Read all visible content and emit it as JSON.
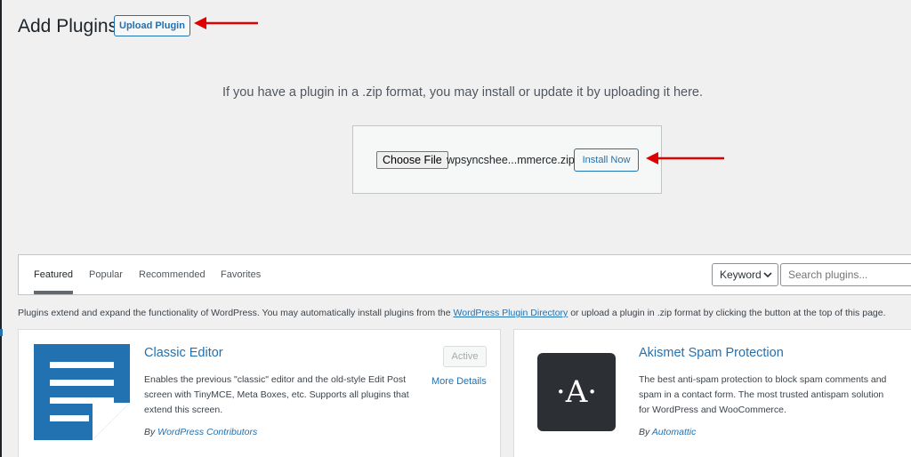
{
  "header": {
    "title": "Add Plugins",
    "upload_button": "Upload Plugin"
  },
  "upload": {
    "help_text": "If you have a plugin in a .zip format, you may install or update it by uploading it here.",
    "choose_file_label": "Choose File",
    "file_name": "wpsyncshee...mmerce.zip",
    "install_button": "Install Now"
  },
  "filter": {
    "tabs": [
      {
        "label": "Featured"
      },
      {
        "label": "Popular"
      },
      {
        "label": "Recommended"
      },
      {
        "label": "Favorites"
      }
    ],
    "search_type": "Keyword",
    "search_placeholder": "Search plugins..."
  },
  "intro": {
    "text_before": "Plugins extend and expand the functionality of WordPress. You may automatically install plugins from the ",
    "link_text": "WordPress Plugin Directory",
    "text_after": " or upload a plugin in .zip format by clicking the button at the top of this page."
  },
  "plugins": [
    {
      "name": "Classic Editor",
      "description": "Enables the previous \"classic\" editor and the old-style Edit Post screen with TinyMCE, Meta Boxes, etc. Supports all plugins that extend this screen.",
      "author_prefix": "By ",
      "author": "WordPress Contributors",
      "status_button": "Active",
      "more_details": "More Details",
      "icon": "document-lines-icon"
    },
    {
      "name": "Akismet Spam Protection",
      "description": "The best anti-spam protection to block spam comments and spam in a contact form. The most trusted antispam solution for WordPress and WooCommerce.",
      "author_prefix": "By ",
      "author": "Automattic",
      "icon_letter": "·A·",
      "icon": "akismet-logo-icon"
    }
  ],
  "colors": {
    "accent": "#2271b1",
    "annotation_arrow": "#e00000",
    "background": "#f0f0f1"
  }
}
